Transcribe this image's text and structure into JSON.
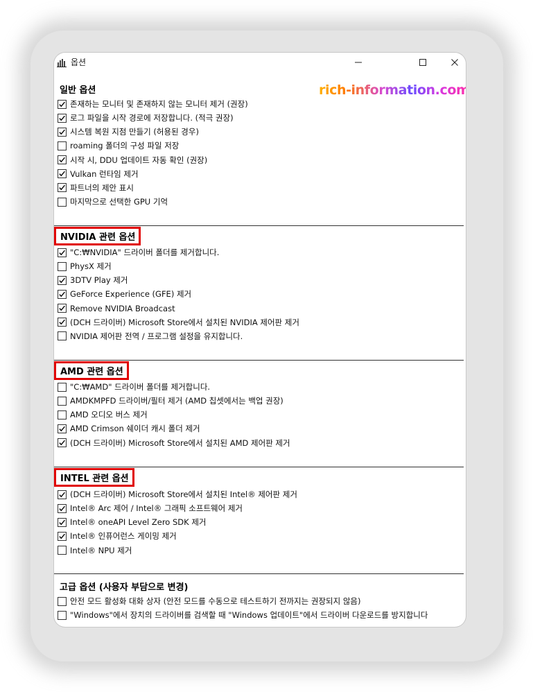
{
  "window": {
    "title": "옵션",
    "watermark": "rich-information.com"
  },
  "sections": [
    {
      "title": "일반 옵션",
      "highlighted": false,
      "items": [
        {
          "label": "존재하는 모니터 및 존재하지 않는 모니터 제거 (권장)",
          "checked": true
        },
        {
          "label": "로그 파일을 시작 경로에 저장합니다. (적극 권장)",
          "checked": true
        },
        {
          "label": "시스템 복원 지점 만들기 (허용된 경우)",
          "checked": true
        },
        {
          "label": "roaming 폴더의 구성 파일 저장",
          "checked": false
        },
        {
          "label": "시작 시, DDU 업데이트 자동 확인 (권장)",
          "checked": true
        },
        {
          "label": "Vulkan 런타임 제거",
          "checked": true
        },
        {
          "label": "파트너의 제안 표시",
          "checked": true
        },
        {
          "label": "마지막으로 선택한 GPU 기억",
          "checked": false
        }
      ]
    },
    {
      "title": "NVIDIA 관련 옵션",
      "highlighted": true,
      "items": [
        {
          "label": "\"C:₩NVIDIA\" 드라이버 폴더를 제거합니다.",
          "checked": true
        },
        {
          "label": "PhysX 제거",
          "checked": false
        },
        {
          "label": "3DTV Play 제거",
          "checked": true
        },
        {
          "label": "GeForce Experience (GFE) 제거",
          "checked": true
        },
        {
          "label": "Remove NVIDIA Broadcast",
          "checked": true
        },
        {
          "label": "(DCH 드라이버) Microsoft Store에서 설치된 NVIDIA 제어판 제거",
          "checked": true
        },
        {
          "label": "NVIDIA 제어판 전역 / 프로그램 설정을 유지합니다.",
          "checked": false
        }
      ]
    },
    {
      "title": "AMD 관련 옵션",
      "highlighted": true,
      "items": [
        {
          "label": "\"C:₩AMD\" 드라이버 폴더를 제거합니다.",
          "checked": false
        },
        {
          "label": "AMDKMPFD 드라이버/필터 제거 (AMD 칩셋에서는 백업 권장)",
          "checked": false
        },
        {
          "label": "AMD 오디오 버스 제거",
          "checked": false
        },
        {
          "label": "AMD Crimson 쉐이더 캐시 폴더 제거",
          "checked": true
        },
        {
          "label": "(DCH 드라이버) Microsoft Store에서 설치된 AMD 제어판 제거",
          "checked": true
        }
      ]
    },
    {
      "title": "INTEL 관련 옵션",
      "highlighted": true,
      "items": [
        {
          "label": "(DCH 드라이버) Microsoft Store에서 설치된 Intel® 제어판 제거",
          "checked": true
        },
        {
          "label": "Intel® Arc 제어 / Intel® 그래픽 소프트웨어 제거",
          "checked": true
        },
        {
          "label": "Intel® oneAPI Level Zero SDK 제거",
          "checked": true
        },
        {
          "label": "Intel® 인퓨어런스 게이밍 제거",
          "checked": true
        },
        {
          "label": "Intel® NPU 제거",
          "checked": false
        }
      ]
    },
    {
      "title": "고급 옵션 (사용자 부담으로 변경)",
      "highlighted": false,
      "items": [
        {
          "label": "안전 모드 활성화 대화 상자 (안전 모드를 수동으로 테스트하기 전까지는 권장되지 않음)",
          "checked": false
        },
        {
          "label": "\"Windows\"에서 장치의 드라이버를 검색할 때 \"Windows 업데이트\"에서 드라이버 다운로드를 방지합니다",
          "checked": false
        }
      ]
    }
  ]
}
